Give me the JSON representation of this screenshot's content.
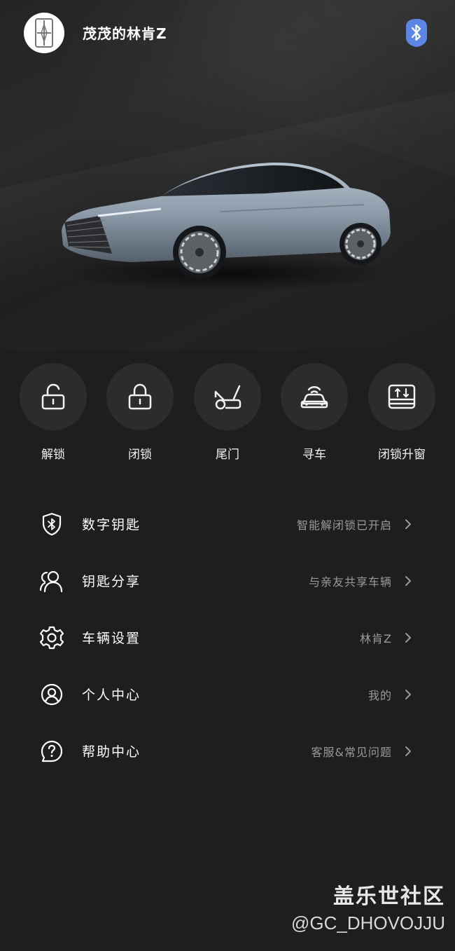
{
  "header": {
    "title": "茂茂的林肯Z",
    "avatar_icon": "lincoln-logo-icon",
    "bluetooth_icon": "bluetooth-icon",
    "bluetooth_color": "#5b86e5"
  },
  "hero": {
    "car_image": "car-image"
  },
  "controls": [
    {
      "label": "解锁",
      "icon": "unlock-icon"
    },
    {
      "label": "闭锁",
      "icon": "lock-icon"
    },
    {
      "label": "尾门",
      "icon": "tailgate-icon"
    },
    {
      "label": "寻车",
      "icon": "find-car-icon"
    },
    {
      "label": "闭锁升窗",
      "icon": "lock-window-icon"
    }
  ],
  "menu": [
    {
      "label": "数字钥匙",
      "value": "智能解闭锁已开启",
      "icon": "bluetooth-shield-icon"
    },
    {
      "label": "钥匙分享",
      "value": "与亲友共享车辆",
      "icon": "share-users-icon"
    },
    {
      "label": "车辆设置",
      "value": "林肯Z",
      "icon": "gear-icon"
    },
    {
      "label": "个人中心",
      "value": "我的",
      "icon": "user-circle-icon"
    },
    {
      "label": "帮助中心",
      "value": "客服&常见问题",
      "icon": "help-icon"
    }
  ],
  "watermark": {
    "line1": "盖乐世社区",
    "line2": "@GC_DHOVOJJU"
  }
}
